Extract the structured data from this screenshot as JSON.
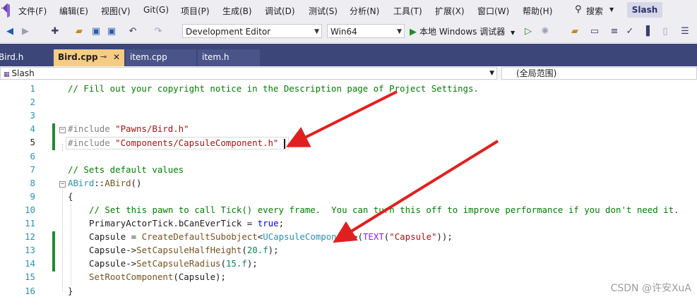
{
  "menu": {
    "items": [
      "文件(F)",
      "编辑(E)",
      "视图(V)",
      "Git(G)",
      "项目(P)",
      "生成(B)",
      "调试(D)",
      "测试(S)",
      "分析(N)",
      "工具(T)",
      "扩展(X)",
      "窗口(W)",
      "帮助(H)"
    ],
    "search_label": "搜索",
    "solution_name": "Slash"
  },
  "toolbar": {
    "configuration": "Development Editor",
    "platform": "Win64",
    "run_label": "本地 Windows 调试器"
  },
  "tabs": [
    {
      "label": "Bird.h"
    },
    {
      "label": "Bird.cpp",
      "active": true
    },
    {
      "label": "item.cpp"
    },
    {
      "label": "item.h"
    }
  ],
  "navbar": {
    "project": "Slash",
    "scope": "(全局范围)"
  },
  "editor": {
    "line_numbers": [
      "1",
      "2",
      "3",
      "4",
      "5",
      "6",
      "7",
      "8",
      "9",
      "10",
      "11",
      "12",
      "13",
      "14",
      "15",
      "16"
    ],
    "current_line": 5,
    "lines": [
      [
        [
          "cm",
          "// Fill out your copyright notice in the Description page of Project Settings."
        ]
      ],
      [],
      [],
      [
        [
          "pp",
          "#include "
        ],
        [
          "str",
          "\"Pawns/Bird.h\""
        ]
      ],
      [
        [
          "pp",
          "#include "
        ],
        [
          "str",
          "\"Components/CapsuleComponent.h\""
        ]
      ],
      [],
      [
        [
          "cm",
          "// Sets default values"
        ]
      ],
      [
        [
          "ty",
          "ABird"
        ],
        [
          "",
          "::"
        ],
        [
          "fn",
          "ABird"
        ],
        [
          "",
          "()"
        ]
      ],
      [
        [
          "",
          "{"
        ]
      ],
      [
        [
          "cm",
          "// Set this pawn to call Tick() every frame.  You can turn this off to improve performance if you don't need it."
        ]
      ],
      [
        [
          "",
          "PrimaryActorTick.bCanEverTick = "
        ],
        [
          "kw",
          "true"
        ],
        [
          "",
          ";"
        ]
      ],
      [
        [
          "",
          "Capsule = "
        ],
        [
          "fn",
          "CreateDefaultSubobject"
        ],
        [
          "",
          "<"
        ],
        [
          "ty",
          "UCapsuleComponent"
        ],
        [
          "",
          ">("
        ],
        [
          "mac",
          "TEXT"
        ],
        [
          "",
          "("
        ],
        [
          "str",
          "\"Capsule\""
        ],
        [
          "",
          "));"
        ]
      ],
      [
        [
          "",
          "Capsule->"
        ],
        [
          "fn",
          "SetCapsuleHalfHeight"
        ],
        [
          "",
          "("
        ],
        [
          "num",
          "20.f"
        ],
        [
          "",
          ");"
        ]
      ],
      [
        [
          "",
          "Capsule->"
        ],
        [
          "fn",
          "SetCapsuleRadius"
        ],
        [
          "",
          "("
        ],
        [
          "num",
          "15.f"
        ],
        [
          "",
          ");"
        ]
      ],
      [
        [
          "fn",
          "SetRootComponent"
        ],
        [
          "",
          "(Capsule);"
        ]
      ],
      [
        [
          "",
          "}"
        ]
      ]
    ]
  },
  "watermark": "CSDN @许安XuA",
  "colors": {
    "tabbar_bg": "#3c4679",
    "active_tab_bg": "#f5cc84",
    "change_bar": "#1f8a2f",
    "annotation_arrow": "#e02020"
  }
}
